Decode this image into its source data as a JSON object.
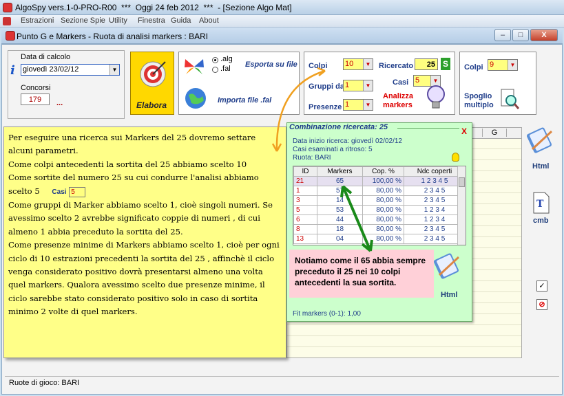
{
  "app": {
    "title": "AlgoSpy vers.1-0-PRO-R00  ***  Oggi 24 feb 2012  ***  - [Sezione Algo Mat]"
  },
  "menu": [
    "Estrazioni",
    "Sezione Spie",
    "Utility",
    "Finestra",
    "Guida",
    "About"
  ],
  "window": {
    "title": "Punto G e Markers - Ruota di analisi markers : BARI",
    "min": "–",
    "max": "□",
    "close": "X"
  },
  "left": {
    "date_label": "Data di calcolo",
    "date_value": "giovedì 23/02/12",
    "concorsi_label": "Concorsi",
    "concorsi_value": "179",
    "dots": "..."
  },
  "elabora": {
    "label": "Elabora"
  },
  "file": {
    "opt_alg": ".alg",
    "opt_fal": ".fal",
    "export": "Esporta su file",
    "import": "Importa file .fal"
  },
  "params": {
    "colpi_label": "Colpi",
    "colpi_value": "10",
    "ricercato_label": "Ricercato",
    "ricercato_value": "25",
    "s_btn": "S",
    "gruppi_label": "Gruppi da",
    "gruppi_value": "1",
    "casi_label": "Casi",
    "casi_value": "5",
    "presenze_label": "Presenze",
    "presenze_value": "1",
    "analizza": "Analizza\nmarkers"
  },
  "spoglio": {
    "colpi_label": "Colpi",
    "colpi_value": "9",
    "label": "Spoglio\nmultiplo"
  },
  "grid": {
    "col_g": "G"
  },
  "note": {
    "lines": [
      "Per eseguire una ricerca sui Markers del 25 dovremo settare alcuni parametri.",
      "Come colpi antecedenti la sortita del 25 abbiamo scelto 10",
      "Come sortite del numero 25 su cui condurre l'analisi abbiamo scelto 5",
      "Come gruppi di Marker abbiamo scelto 1, cioè singoli numeri. Se avessimo scelto 2 avrebbe significato coppie di numeri , di cui almeno 1 abbia preceduto la sortita del 25.",
      "Come presenze minime di Markers abbiamo scelto 1, cioè per ogni ciclo di 10 estrazioni precedenti la sortita del 25 , affinchè il ciclo venga considerato positivo dovrà presentarsi almeno una volta quel markers. Qualora avessimo scelto due presenze minime, il ciclo sarebbe stato considerato positivo solo in caso di sortita minimo 2 volte di quel markers."
    ],
    "casi_label": "Casi",
    "casi_value": "5"
  },
  "combo": {
    "title": "Combinazione ricercata: 25",
    "close": "X",
    "data_inizio": "Data inizio ricerca: giovedì 02/02/12",
    "casi": "Casi esaminati a ritroso: 5",
    "ruota": "Ruota: BARI",
    "headers": [
      "ID",
      "Markers",
      "Cop. %",
      "Ndc coperti"
    ],
    "rows": [
      [
        "21",
        "65",
        "100,00 %",
        "1 2 3 4 5"
      ],
      [
        "1",
        "57",
        "80,00 %",
        "2 3 4 5"
      ],
      [
        "3",
        "14",
        "80,00 %",
        "2 3 4 5"
      ],
      [
        "5",
        "53",
        "80,00 %",
        "1 2 3 4"
      ],
      [
        "6",
        "44",
        "80,00 %",
        "1 2 3 4"
      ],
      [
        "8",
        "18",
        "80,00 %",
        "2 3 4 5"
      ],
      [
        "13",
        "04",
        "80,00 %",
        "2 3 4 5"
      ]
    ],
    "fit": "Fit markers (0-1): 1,00",
    "html": "Html"
  },
  "pink_note": "Notiamo come il 65 abbia sempre preceduto il 25 nei 10 colpi antecedenti la sua sortita.",
  "side": {
    "html": "Html",
    "cmb": "cmb"
  },
  "status": "Ruote di gioco: BARI",
  "colors": {
    "accent_red": "#cc0000",
    "combo_bg": "#ccffcc",
    "note_bg": "#ffff88",
    "elabora_bg": "#ffd800",
    "arrow_orange": "#f0a020",
    "arrow_green": "#1a8a1a"
  }
}
